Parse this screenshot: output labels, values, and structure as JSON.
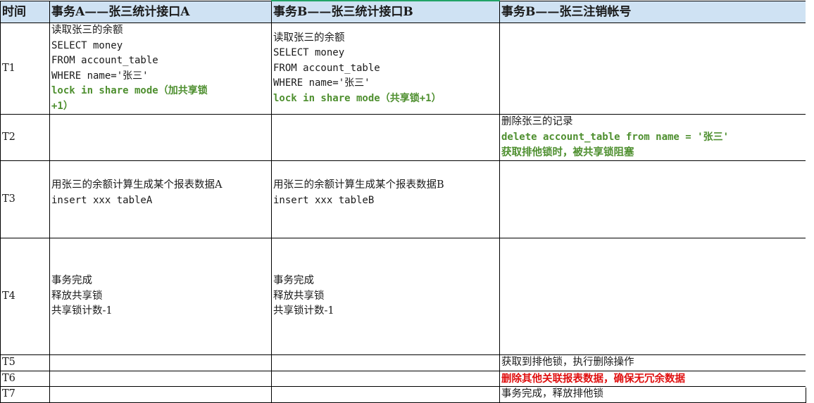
{
  "header": {
    "time": "时间",
    "txA": "事务A——张三统计接口A",
    "txB": "事务B——张三统计接口B",
    "txC": "事务B——张三注销帐号"
  },
  "rows": {
    "t1": {
      "label": "T1",
      "a": [
        "读取张三的余额",
        "SELECT money",
        "FROM account_table",
        "WHERE name='张三'",
        "lock in share mode（加共享锁",
        "+1）"
      ],
      "b": [
        "读取张三的余额",
        "SELECT money",
        "FROM account_table",
        "WHERE name='张三'",
        "lock in share mode（共享锁+1）"
      ]
    },
    "t2": {
      "label": "T2",
      "c": [
        "删除张三的记录",
        "delete account_table from name = '张三'",
        "获取排他锁时，被共享锁阻塞"
      ]
    },
    "t3": {
      "label": "T3",
      "a": [
        "用张三的余额计算生成某个报表数据A",
        "insert xxx tableA"
      ],
      "b": [
        "用张三的余额计算生成某个报表数据B",
        "insert xxx tableB"
      ]
    },
    "t4": {
      "label": "T4",
      "a": [
        "事务完成",
        "释放共享锁",
        "共享锁计数-1"
      ],
      "b": [
        "事务完成",
        "释放共享锁",
        "共享锁计数-1"
      ]
    },
    "t5": {
      "label": "T5",
      "c": "获取到排他锁，执行删除操作"
    },
    "t6": {
      "label": "T6",
      "c": "删除其他关联报表数据，确保无冗余数据"
    },
    "t7": {
      "label": "T7",
      "c": "事务完成，释放排他锁"
    }
  },
  "colors": {
    "header_bg": "#cfe2f3",
    "green_text": "#4e8f2f",
    "red_text": "#e01010",
    "selection_border": "#21a366"
  }
}
